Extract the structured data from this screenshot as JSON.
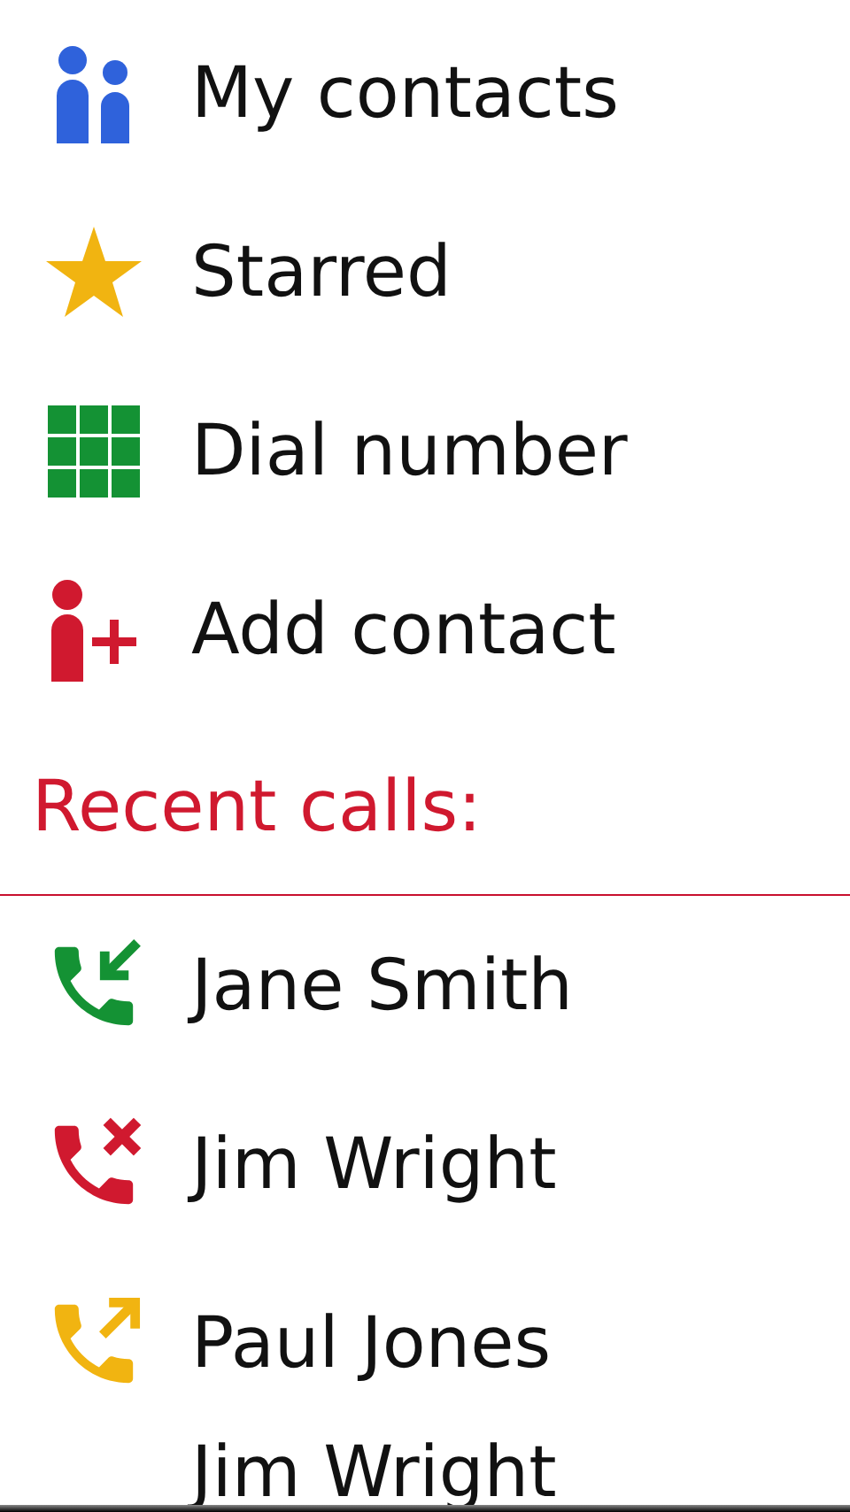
{
  "menu": [
    {
      "label": "My contacts",
      "kind": "contacts"
    },
    {
      "label": "Starred",
      "kind": "starred"
    },
    {
      "label": "Dial number",
      "kind": "dial"
    },
    {
      "label": "Add contact",
      "kind": "add"
    }
  ],
  "recent_calls": {
    "heading": "Recent calls:",
    "calls": [
      {
        "name": "Jane Smith",
        "kind": "incoming"
      },
      {
        "name": "Jim Wright",
        "kind": "missed"
      },
      {
        "name": "Paul Jones",
        "kind": "outgoing"
      },
      {
        "name": "Jim Wright"
      }
    ]
  }
}
